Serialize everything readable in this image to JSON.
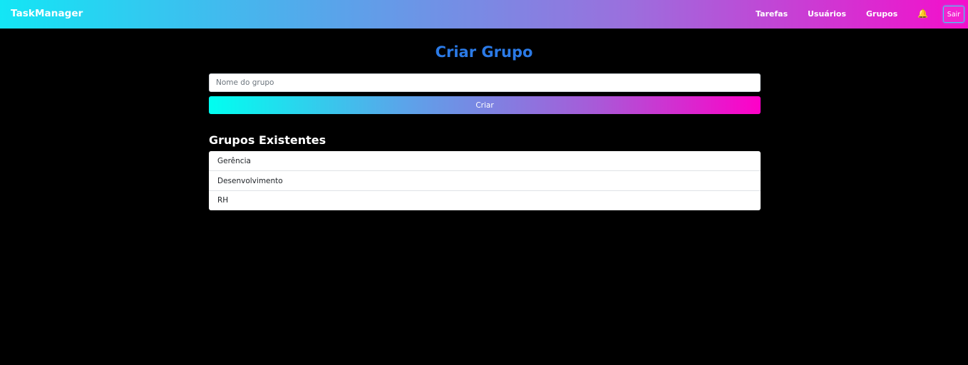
{
  "navbar": {
    "brand": "TaskManager",
    "links": [
      {
        "label": "Tarefas"
      },
      {
        "label": "Usuários"
      },
      {
        "label": "Grupos"
      }
    ],
    "bell_icon": "🔔",
    "logout_label": "Sair"
  },
  "main": {
    "title": "Criar Grupo",
    "group_name_placeholder": "Nome do grupo",
    "create_label": "Criar",
    "existing_title": "Grupos Existentes",
    "groups": [
      {
        "name": "Gerência"
      },
      {
        "name": "Desenvolvimento"
      },
      {
        "name": "RH"
      }
    ]
  },
  "colors": {
    "title": "#2b7ae6",
    "gradient_start": "#00fff0",
    "gradient_end": "#ff00c8",
    "background": "#000000"
  }
}
